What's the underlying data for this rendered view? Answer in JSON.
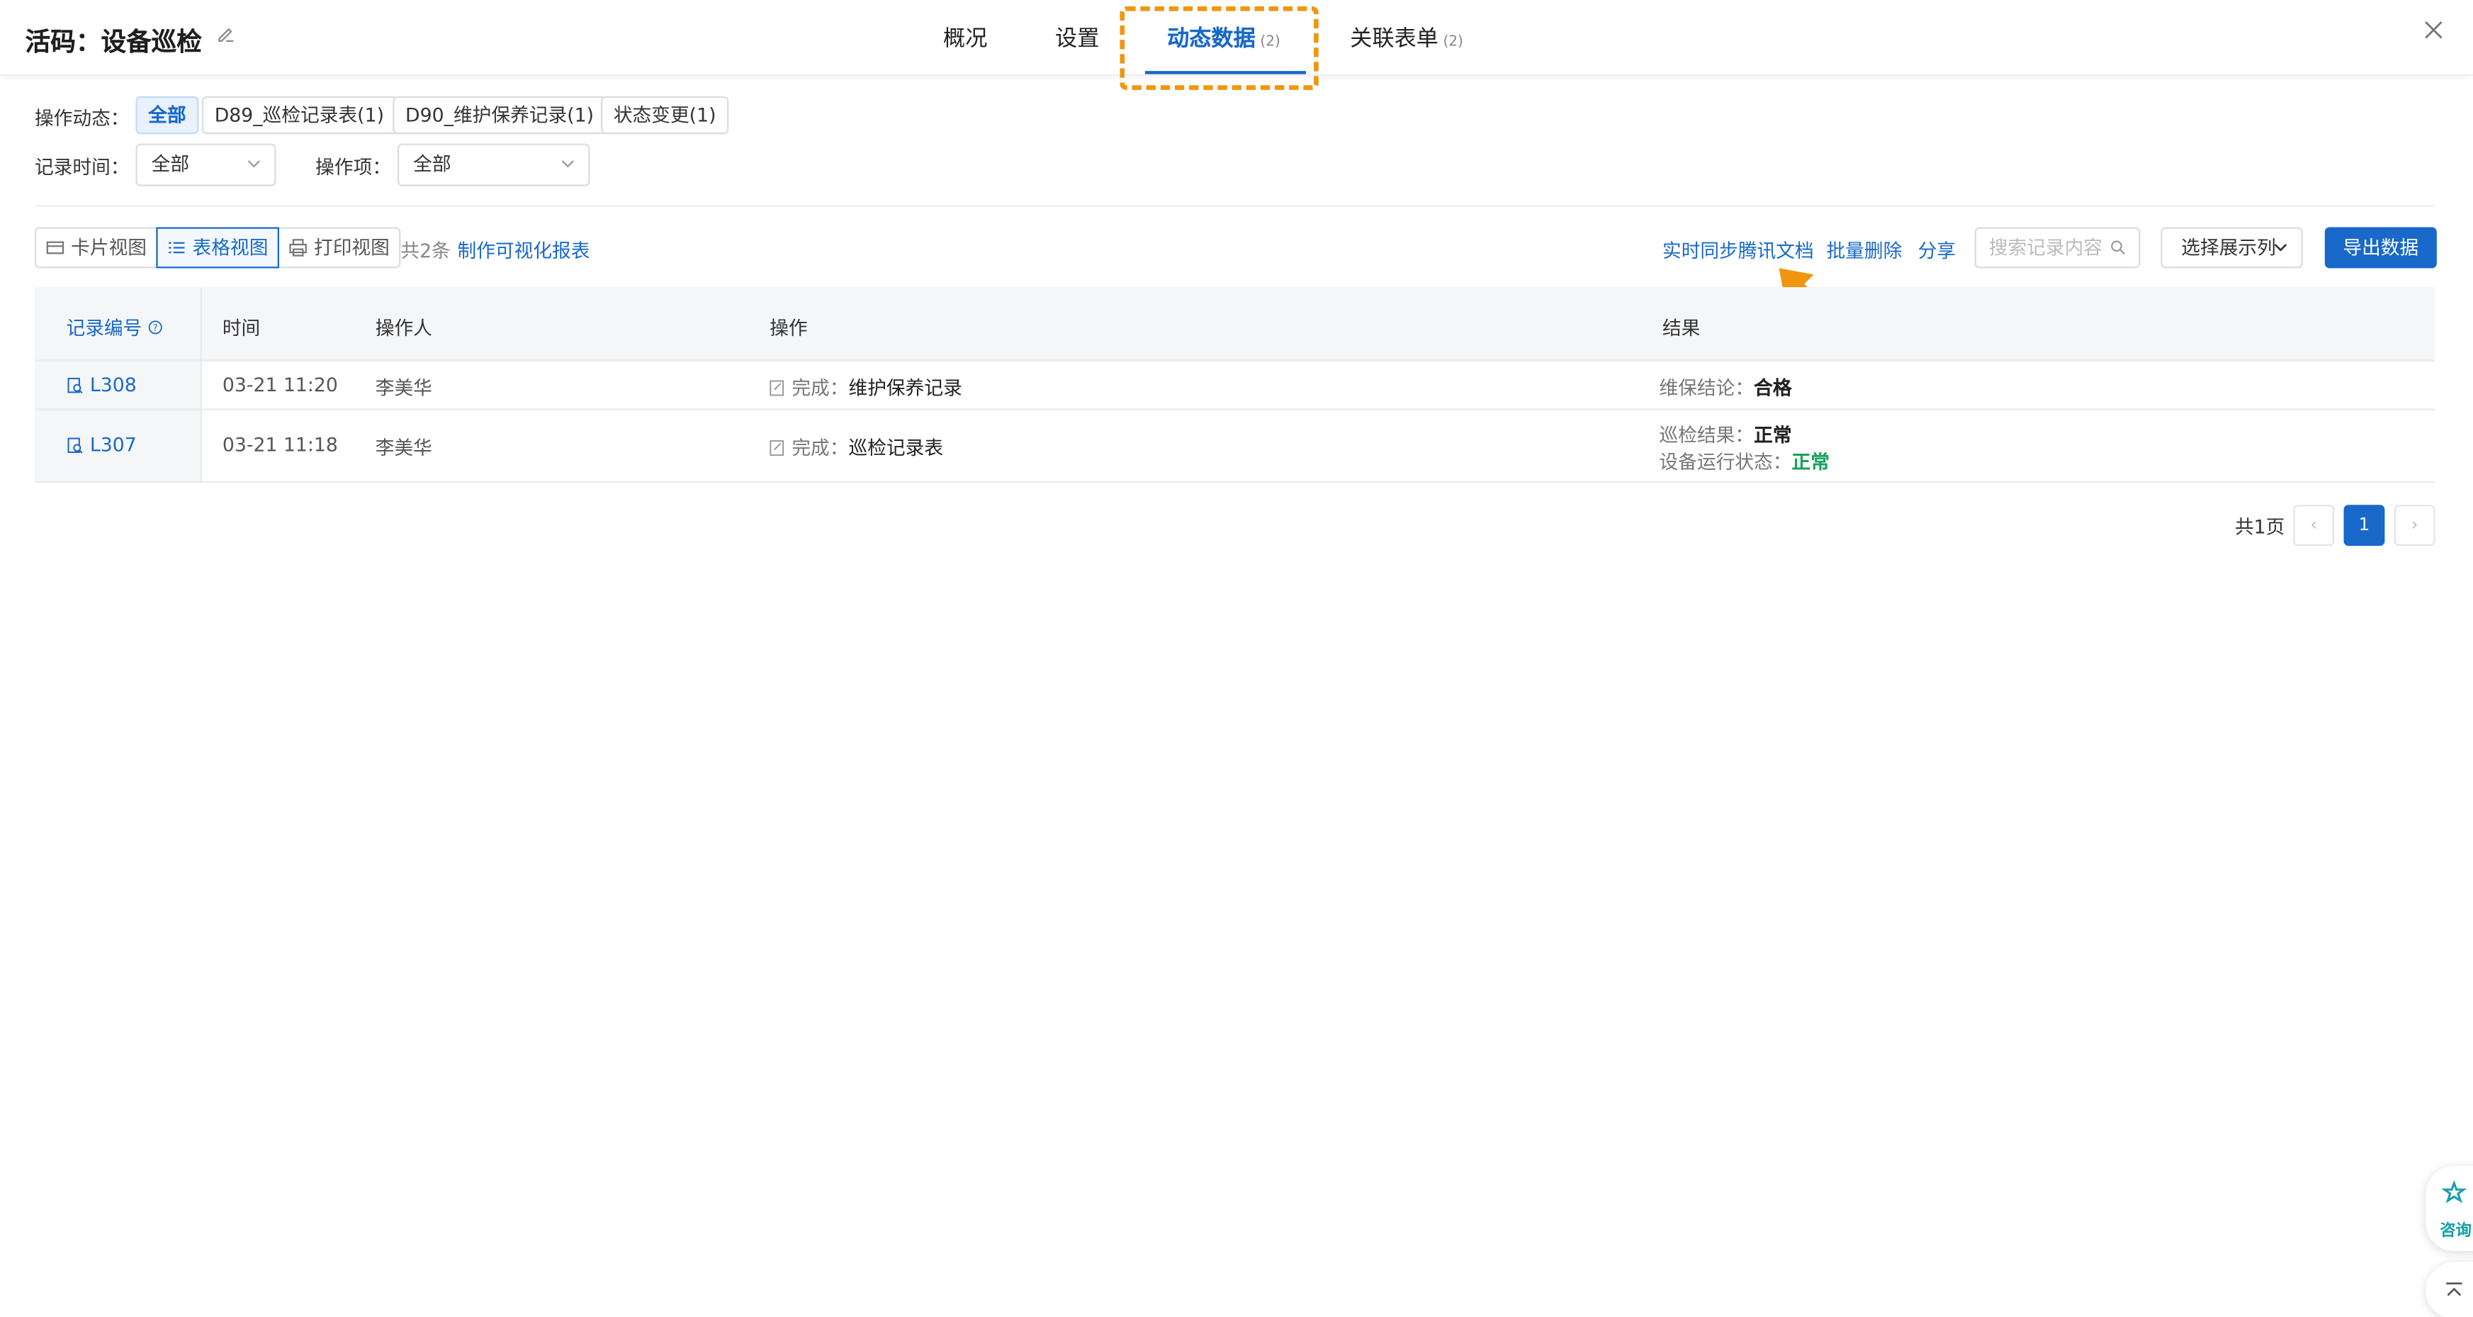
{
  "header": {
    "title": "活码：设备巡检",
    "tabs": [
      {
        "label": "概况",
        "count": ""
      },
      {
        "label": "设置",
        "count": ""
      },
      {
        "label": "动态数据",
        "count": "(2)"
      },
      {
        "label": "关联表单",
        "count": "(2)"
      }
    ],
    "active_tab": "动态数据"
  },
  "filters": {
    "op_label": "操作动态：",
    "chips": [
      "全部",
      "D89_巡检记录表(1)",
      "D90_维护保养记录(1)",
      "状态变更(1)"
    ],
    "time_label": "记录时间：",
    "time_value": "全部",
    "item_label": "操作项：",
    "item_value": "全部"
  },
  "toolbar": {
    "card_view": "卡片视图",
    "table_view": "表格视图",
    "print_view": "打印视图",
    "total": "共2条",
    "make_report": "制作可视化报表",
    "sync_tencent": "实时同步腾讯文档",
    "batch_delete": "批量删除",
    "share": "分享",
    "search_placeholder": "搜索记录内容",
    "select_columns": "选择展示列",
    "export": "导出数据"
  },
  "table": {
    "headers": {
      "id": "记录编号",
      "time": "时间",
      "operator": "操作人",
      "action": "操作",
      "result": "结果"
    },
    "rows": [
      {
        "id": "L308",
        "time": "03-21 11:20",
        "operator": "李美华",
        "action_prefix": "完成：",
        "action_target": "维护保养记录",
        "results": [
          {
            "label": "维保结论：",
            "value": "合格",
            "status": "normal"
          }
        ]
      },
      {
        "id": "L307",
        "time": "03-21 11:18",
        "operator": "李美华",
        "action_prefix": "完成：",
        "action_target": "巡检记录表",
        "results": [
          {
            "label": "巡检结果：",
            "value": "正常",
            "status": "normal"
          },
          {
            "label": "设备运行状态：",
            "value": "正常",
            "status": "green"
          }
        ]
      }
    ]
  },
  "pagination": {
    "total_pages": "共1页",
    "current": "1",
    "prev": "‹",
    "next": "›"
  },
  "floating": {
    "consult": "咨询"
  },
  "colors": {
    "accent": "#1869c9",
    "highlight": "#f0960e",
    "green": "#18a35b"
  }
}
